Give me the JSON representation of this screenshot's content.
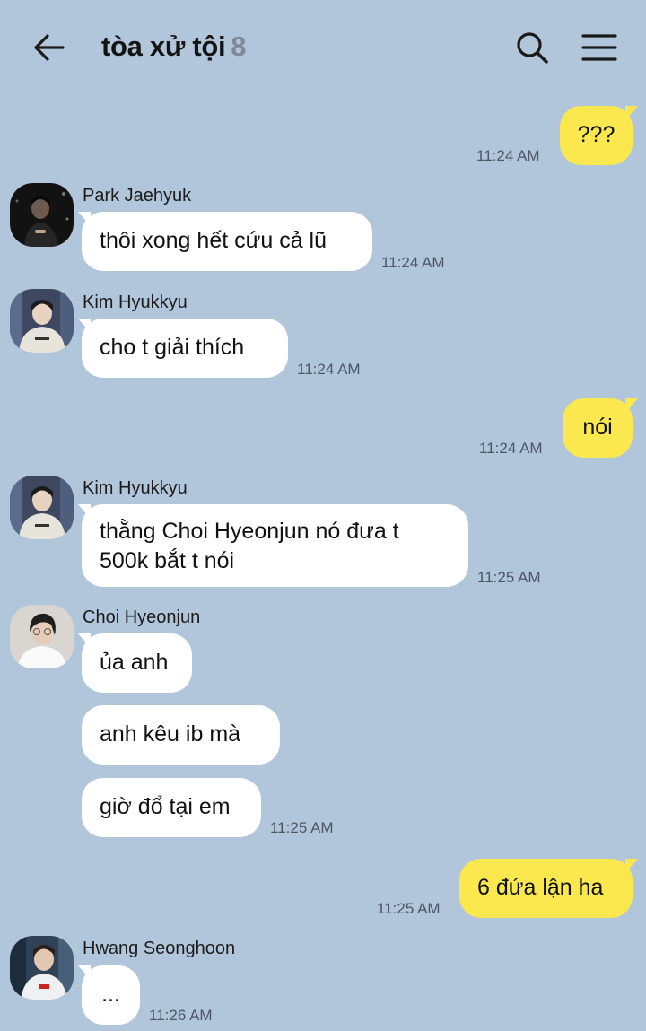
{
  "header": {
    "title": "tòa xử tội",
    "member_count": "8",
    "back_icon": "arrow-left-icon",
    "search_icon": "search-icon",
    "menu_icon": "hamburger-menu-icon"
  },
  "colors": {
    "background": "#b1c6da",
    "outgoing_bubble": "#fbe84f",
    "incoming_bubble": "#ffffff",
    "timestamp": "#4c5763"
  },
  "messages": [
    {
      "direction": "out",
      "text": "???",
      "time": "11:24 AM"
    },
    {
      "direction": "in",
      "sender": "Park Jaehyuk",
      "text": "thôi xong hết cứu cả lũ",
      "time": "11:24 AM"
    },
    {
      "direction": "in",
      "sender": "Kim Hyukkyu",
      "text": "cho t giải thích",
      "time": "11:24 AM"
    },
    {
      "direction": "out",
      "text": "nói",
      "time": "11:24 AM"
    },
    {
      "direction": "in",
      "sender": "Kim Hyukkyu",
      "lines": [
        "thằng Choi Hyeonjun nó đưa t",
        "500k bắt t nói"
      ],
      "time": "11:25 AM"
    },
    {
      "direction": "in",
      "sender": "Choi Hyeonjun",
      "text": "ủa anh"
    },
    {
      "direction": "in",
      "text": "anh kêu ib mà"
    },
    {
      "direction": "in",
      "text": "giờ đổ tại em",
      "time": "11:25 AM"
    },
    {
      "direction": "out",
      "text": "6 đứa lận ha",
      "time": "11:25 AM"
    },
    {
      "direction": "in",
      "sender": "Hwang Seonghoon",
      "text": "...",
      "time": "11:26 AM"
    }
  ]
}
